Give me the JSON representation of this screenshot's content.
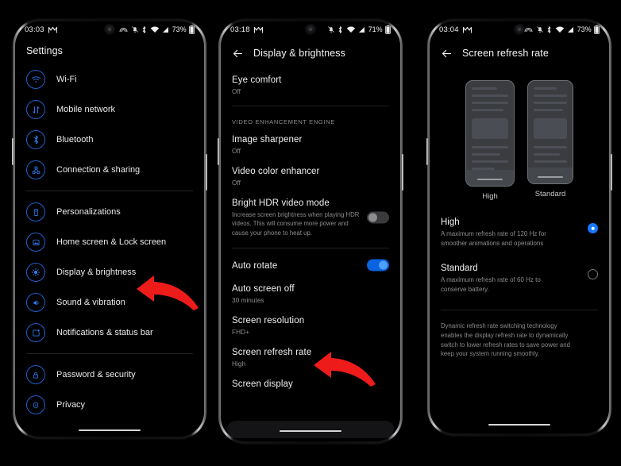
{
  "accent": "#1578ff",
  "arrow_color": "#ee1b1b",
  "phone1": {
    "status": {
      "time": "03:03",
      "battery_pct": "73%",
      "icons": [
        "messages-icon",
        "vpn-icon",
        "bell-muted-icon",
        "bluetooth-icon",
        "wifi-icon",
        "signal-icon",
        "battery-icon"
      ]
    },
    "title": "Settings",
    "groups": [
      {
        "items": [
          {
            "label": "Wi-Fi",
            "icon": "wifi-icon"
          },
          {
            "label": "Mobile network",
            "icon": "mobile-network-icon"
          },
          {
            "label": "Bluetooth",
            "icon": "bluetooth-icon"
          },
          {
            "label": "Connection & sharing",
            "icon": "connection-sharing-icon"
          }
        ]
      },
      {
        "items": [
          {
            "label": "Personalizations",
            "icon": "personalization-icon"
          },
          {
            "label": "Home screen & Lock screen",
            "icon": "home-lock-screen-icon"
          },
          {
            "label": "Display & brightness",
            "icon": "display-brightness-icon"
          },
          {
            "label": "Sound & vibration",
            "icon": "sound-vibration-icon"
          },
          {
            "label": "Notifications & status bar",
            "icon": "notifications-icon"
          }
        ]
      },
      {
        "items": [
          {
            "label": "Password & security",
            "icon": "lock-icon"
          },
          {
            "label": "Privacy",
            "icon": "privacy-shield-icon"
          }
        ]
      }
    ]
  },
  "phone2": {
    "status": {
      "time": "03:18",
      "battery_pct": "71%"
    },
    "title": "Display & brightness",
    "rows": {
      "eye_comfort": {
        "title": "Eye comfort",
        "value": "Off"
      },
      "section_video": "VIDEO ENHANCEMENT ENGINE",
      "image_sharpener": {
        "title": "Image sharpener",
        "value": "Off"
      },
      "video_color": {
        "title": "Video color enhancer",
        "value": "Off"
      },
      "bright_hdr": {
        "title": "Bright HDR video mode",
        "desc": "Increase screen brightness when playing HDR videos. This will consume more power and cause your phone to heat up.",
        "toggle": "off"
      },
      "auto_rotate": {
        "title": "Auto rotate",
        "toggle": "on"
      },
      "auto_screen_off": {
        "title": "Auto screen off",
        "value": "30 minutes"
      },
      "screen_resolution": {
        "title": "Screen resolution",
        "value": "FHD+"
      },
      "screen_refresh_rate": {
        "title": "Screen refresh rate",
        "value": "High"
      },
      "screen_display": {
        "title": "Screen display",
        "value": ""
      }
    }
  },
  "phone3": {
    "status": {
      "time": "03:04",
      "battery_pct": "73%"
    },
    "title": "Screen refresh rate",
    "previews": [
      {
        "name": "High"
      },
      {
        "name": "Standard"
      }
    ],
    "options": [
      {
        "title": "High",
        "desc": "A maximum refresh rate of 120 Hz for smoother animations and operations",
        "selected": true
      },
      {
        "title": "Standard",
        "desc": "A maximum refresh rate of 60 Hz to conserve battery.",
        "selected": false
      }
    ],
    "note": "Dynamic refresh rate switching technology enables the display refresh rate to dynamically switch to lower refresh rates to save power and keep your system running smoothly."
  }
}
